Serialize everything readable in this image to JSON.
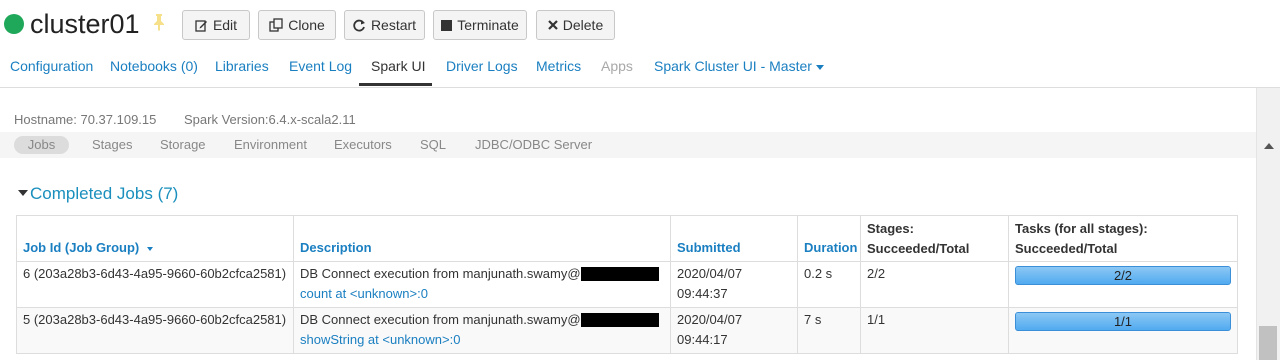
{
  "cluster": {
    "name": "cluster01",
    "status_color": "#1fa85a"
  },
  "toolbar": {
    "edit_label": "Edit",
    "clone_label": "Clone",
    "restart_label": "Restart",
    "terminate_label": "Terminate",
    "delete_label": "Delete"
  },
  "tabs": [
    {
      "label": "Configuration"
    },
    {
      "label": "Notebooks (0)"
    },
    {
      "label": "Libraries"
    },
    {
      "label": "Event Log"
    },
    {
      "label": "Spark UI",
      "active": true
    },
    {
      "label": "Driver Logs"
    },
    {
      "label": "Metrics"
    },
    {
      "label": "Apps",
      "disabled": true
    },
    {
      "label": "Spark Cluster UI - Master"
    }
  ],
  "info": {
    "hostname": "Hostname: 70.37.109.15",
    "spark_version": "Spark Version:6.4.x-scala2.11"
  },
  "spark_nav": [
    "Jobs",
    "Stages",
    "Storage",
    "Environment",
    "Executors",
    "SQL",
    "JDBC/ODBC Server"
  ],
  "completed_jobs": {
    "title": "Completed Jobs (7)",
    "headers": {
      "job_id": "Job Id (Job Group)",
      "description": "Description",
      "submitted": "Submitted",
      "duration": "Duration",
      "stages_1": "Stages:",
      "stages_2": "Succeeded/Total",
      "tasks_1": "Tasks (for all stages):",
      "tasks_2": "Succeeded/Total"
    },
    "rows": [
      {
        "job_id": "6 (203a28b3-6d43-4a95-9660-60b2cfca2581)",
        "desc": "DB Connect execution from manjunath.swamy@",
        "desc_link": "count at <unknown>:0",
        "submitted_date": "2020/04/07",
        "submitted_time": "09:44:37",
        "duration": "0.2 s",
        "stages": "2/2",
        "tasks": "2/2",
        "tasks_fraction": 1.0
      },
      {
        "job_id": "5 (203a28b3-6d43-4a95-9660-60b2cfca2581)",
        "desc": "DB Connect execution from manjunath.swamy@",
        "desc_link": "showString at <unknown>:0",
        "submitted_date": "2020/04/07",
        "submitted_time": "09:44:17",
        "duration": "7 s",
        "stages": "1/1",
        "tasks": "1/1",
        "tasks_fraction": 1.0
      }
    ]
  }
}
